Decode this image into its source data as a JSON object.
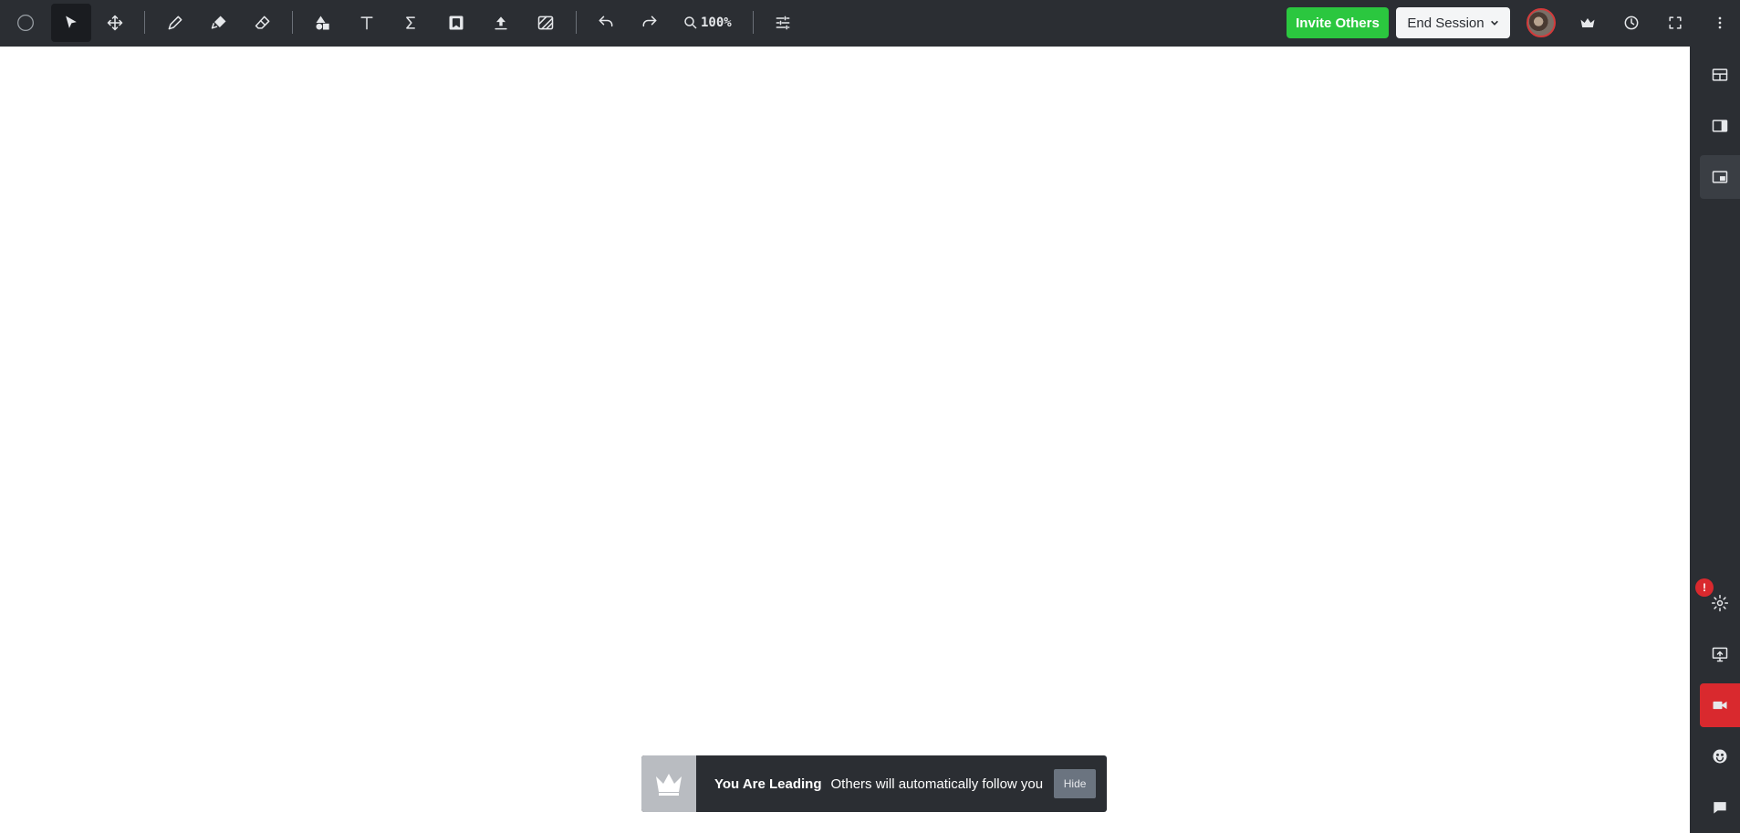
{
  "toolbar": {
    "tools": [
      {
        "name": "color-picker",
        "icon": "circle-icon"
      },
      {
        "name": "select-tool",
        "icon": "cursor-icon",
        "active": true
      },
      {
        "name": "move-tool",
        "icon": "move-arrows-icon"
      },
      {
        "name": "pen-tool",
        "icon": "pencil-icon"
      },
      {
        "name": "marker-tool",
        "icon": "marker-icon"
      },
      {
        "name": "eraser-tool",
        "icon": "eraser-icon"
      },
      {
        "name": "shapes-tool",
        "icon": "shapes-icon"
      },
      {
        "name": "text-tool",
        "icon": "text-icon"
      },
      {
        "name": "math-tool",
        "icon": "sigma-icon"
      },
      {
        "name": "sticky-note-tool",
        "icon": "note-icon"
      },
      {
        "name": "upload-tool",
        "icon": "upload-icon"
      },
      {
        "name": "background-tool",
        "icon": "hatch-icon"
      },
      {
        "name": "undo",
        "icon": "undo-icon"
      },
      {
        "name": "redo",
        "icon": "redo-icon"
      },
      {
        "name": "settings-sliders",
        "icon": "sliders-icon"
      }
    ],
    "zoom_label": "100%",
    "invite_label": "Invite Others",
    "end_session_label": "End Session",
    "invite_color": "#2bc73f"
  },
  "rail": {
    "top_icons": [
      "layout-icon",
      "panel-icon",
      "picture-in-picture-icon"
    ],
    "bottom_icons": [
      "gear-icon",
      "screen-share-icon",
      "video-camera-icon",
      "smiley-icon",
      "chat-icon"
    ],
    "alert_badge": "!",
    "danger_color": "#d9292e"
  },
  "toast": {
    "title": "You Are Leading",
    "message": "Others will automatically follow you",
    "hide_label": "Hide",
    "icon": "crown-icon"
  }
}
